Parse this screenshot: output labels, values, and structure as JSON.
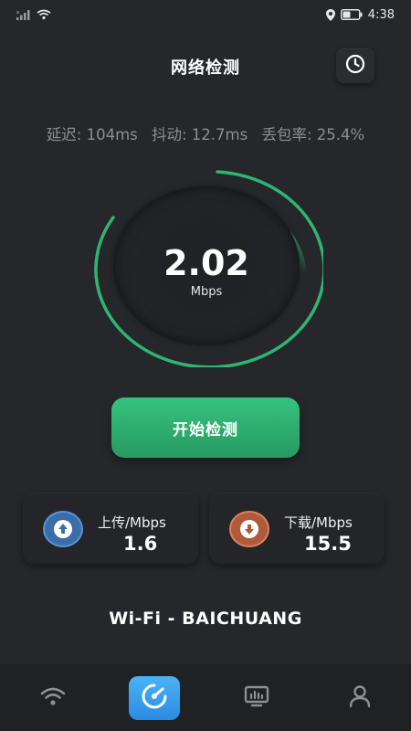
{
  "status_bar": {
    "time": "4:38"
  },
  "header": {
    "title": "网络检测"
  },
  "stats": {
    "latency": "延迟: 104ms",
    "jitter": "抖动: 12.7ms",
    "packet_loss": "丢包率: 25.4%"
  },
  "gauge": {
    "speed_value": "2.02",
    "speed_unit": "Mbps"
  },
  "start_button": {
    "label": "开始检测"
  },
  "upload_card": {
    "label": "上传/Mbps",
    "value": "1.6"
  },
  "download_card": {
    "label": "下载/Mbps",
    "value": "15.5"
  },
  "network": {
    "name": "Wi-Fi - BAICHUANG"
  },
  "bottom_nav": {
    "items": [
      {
        "icon": "wifi-icon",
        "active": false
      },
      {
        "icon": "speedometer-icon",
        "active": true
      },
      {
        "icon": "monitor-icon",
        "active": false
      },
      {
        "icon": "user-icon",
        "active": false
      }
    ]
  },
  "colors": {
    "background": "#25272a",
    "accent_green": "#2fb573",
    "upload_blue": "#3b6ea8",
    "download_orange": "#b05a3c",
    "nav_active_blue": "#2b8be2"
  }
}
